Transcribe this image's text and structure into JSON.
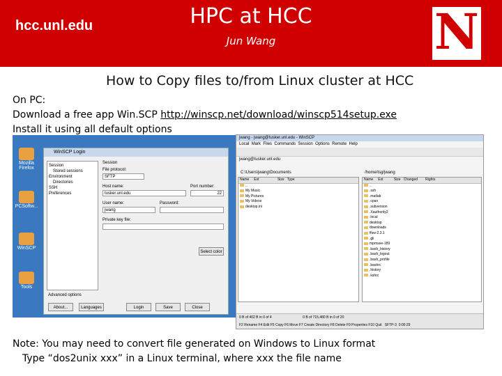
{
  "header": {
    "site": "hcc.unl.edu",
    "title": "HPC at HCC",
    "author": "Jun Wang",
    "logo_letter": "N",
    "bg_color": "#d00000"
  },
  "slide": {
    "subtitle": "How to Copy files to/from Linux cluster at HCC",
    "line1": "On PC:",
    "line2_prefix": "Download a free app Win.SCP ",
    "link": "http://winscp.net/download/winscp514setup.exe",
    "line3": "Install it using all default options",
    "note1": "Note: You may need to convert file generated on Windows to Linux format",
    "note2": "Type “dos2unix xxx” in a Linux terminal, where xxx the file name"
  },
  "login_window": {
    "title": "WinSCP Login",
    "tree": [
      "Session",
      "Stored sessions",
      "Environment",
      "Directories",
      "SSH",
      "Preferences"
    ],
    "session_label": "Session",
    "protocol_label": "File protocol:",
    "protocol_value": "SFTP",
    "host_label": "Host name:",
    "host_value": "tusker.unl.edu",
    "port_label": "Port number:",
    "port_value": "22",
    "user_label": "User name:",
    "user_value": "jwang",
    "password_label": "Password:",
    "key_label": "Private key file:",
    "select_color_button": "Select color",
    "advanced_label": "Advanced options",
    "buttons": [
      "About...",
      "Languages",
      "Login",
      "Save",
      "Close"
    ]
  },
  "desktop_icons": [
    "Mozilla Firefox",
    "PCSoftw...",
    "WinSCP",
    "Tools"
  ],
  "commander_window": {
    "title": "jwang - jwang@tusker.unl.edu - WinSCP",
    "menu": [
      "Local",
      "Mark",
      "Files",
      "Commands",
      "Session",
      "Options",
      "Remote",
      "Help"
    ],
    "session_tab": "jwang@tusker.unl.edu",
    "local_path": "C:\\Users\\jwang\\Documents",
    "remote_path": "/home/tsg/jwang",
    "local_headers": [
      "Name",
      "Ext",
      "Size",
      "Type"
    ],
    "local_rows": [
      "..",
      "My Music",
      "My Pictures",
      "My Videos",
      "desktop.ini"
    ],
    "remote_headers": [
      "Name",
      "Ext",
      "Size",
      "Changed",
      "Rights"
    ],
    "remote_rows": [
      "..",
      ".ssh",
      ".matlab",
      ".cpan",
      ".subversion",
      ".Xauthority2",
      ".local",
      "desktop",
      "downloads",
      "ffsw-2.3.1",
      ".gli",
      "mpmsee-189",
      ".bash_history",
      ".bash_logout",
      ".bash_profile",
      ".bashrc",
      ".history",
      ".kshrc"
    ],
    "local_status": "0 B of 402 B in 0 of 4",
    "remote_status": "0 B of 715,480 B in 0 of 20",
    "bottom_bar": "F2 Rename  F4 Edit  F5 Copy  F6 Move  F7 Create Directory  F8 Delete  F9 Properties  F10 Quit",
    "protocol": "SFTP-3",
    "time": "0:00:29"
  }
}
